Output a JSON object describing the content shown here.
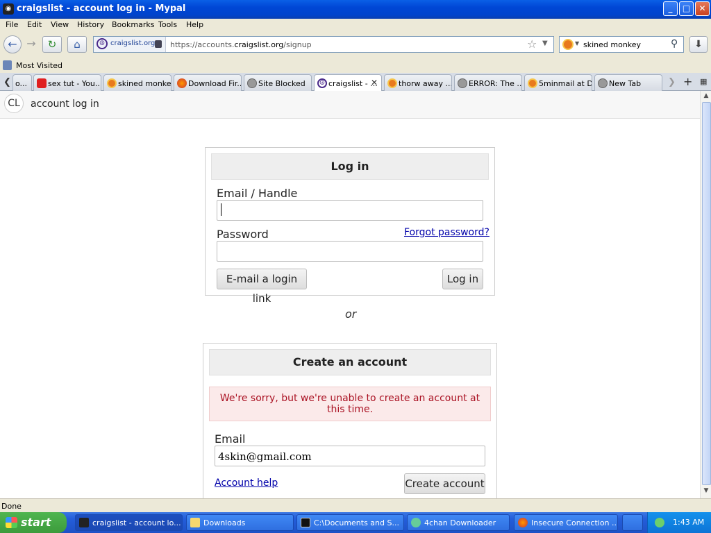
{
  "window": {
    "title": "craigslist - account log in - Mypal",
    "min": "_",
    "max": "□",
    "close": "✕"
  },
  "menu": [
    "File",
    "Edit",
    "View",
    "History",
    "Bookmarks",
    "Tools",
    "Help"
  ],
  "nav": {
    "site_label": "craigslist.org",
    "url_prefix": "https://accounts.",
    "url_domain": "craigslist.org",
    "url_path": "/signup",
    "search_value": "skined monkey"
  },
  "bookmarks": {
    "most_visited": "Most Visited"
  },
  "tabs": [
    {
      "label": "o..."
    },
    {
      "label": "sex tut - You..."
    },
    {
      "label": "skined monke..."
    },
    {
      "label": "Download Fir..."
    },
    {
      "label": "Site Blocked"
    },
    {
      "label": "craigslist - ...",
      "active": true
    },
    {
      "label": "thorw away ..."
    },
    {
      "label": "ERROR: The ..."
    },
    {
      "label": "5minmail at D..."
    },
    {
      "label": "New Tab"
    }
  ],
  "page": {
    "logo": "CL",
    "header": "account log in",
    "login": {
      "title": "Log in",
      "email_label": "Email / Handle",
      "email_value": "",
      "password_label": "Password",
      "forgot": "Forgot password?",
      "email_link_button": "E-mail a login link",
      "login_button": "Log in"
    },
    "or": "or",
    "create": {
      "title": "Create an account",
      "error": "We're sorry, but we're unable to create an account at this time.",
      "email_label": "Email",
      "email_value": "4skin@gmail.com",
      "help_link": "Account help",
      "create_button": "Create account"
    }
  },
  "status": "Done",
  "taskbar": {
    "start": "start",
    "items": [
      {
        "label": "craigslist - account lo...",
        "active": true
      },
      {
        "label": "Downloads"
      },
      {
        "label": "C:\\Documents and S..."
      },
      {
        "label": "4chan Downloader"
      },
      {
        "label": "Insecure Connection ..."
      }
    ],
    "clock": "1:43 AM"
  }
}
